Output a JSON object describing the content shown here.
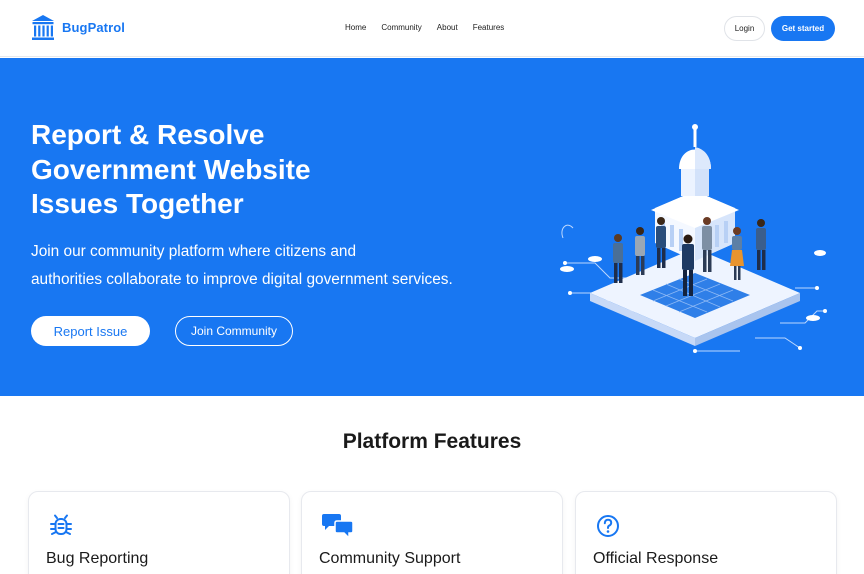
{
  "nav": {
    "brand_name": "BugPatrol",
    "links": [
      "Home",
      "Community",
      "About",
      "Features"
    ],
    "login_label": "Login",
    "get_started_label": "Get started"
  },
  "hero": {
    "title_lines": [
      "Report & Resolve",
      "Government Website",
      "Issues Together"
    ],
    "subtitle_lines": [
      "Join our community platform where citizens and",
      "authorities collaborate to improve digital government services."
    ],
    "report_button": "Report Issue",
    "join_button": "Join Community",
    "illustration_icon": "government-building-people-illustration"
  },
  "features": {
    "heading": "Platform Features",
    "cards": [
      {
        "title": "Bug Reporting",
        "icon": "bug-icon"
      },
      {
        "title": "Community Support",
        "icon": "chat-bubbles-icon"
      },
      {
        "title": "Official Response",
        "icon": "question-circle-icon"
      }
    ]
  },
  "colors": {
    "primary": "#1877f2",
    "white": "#ffffff",
    "text": "#1a1a1a"
  }
}
